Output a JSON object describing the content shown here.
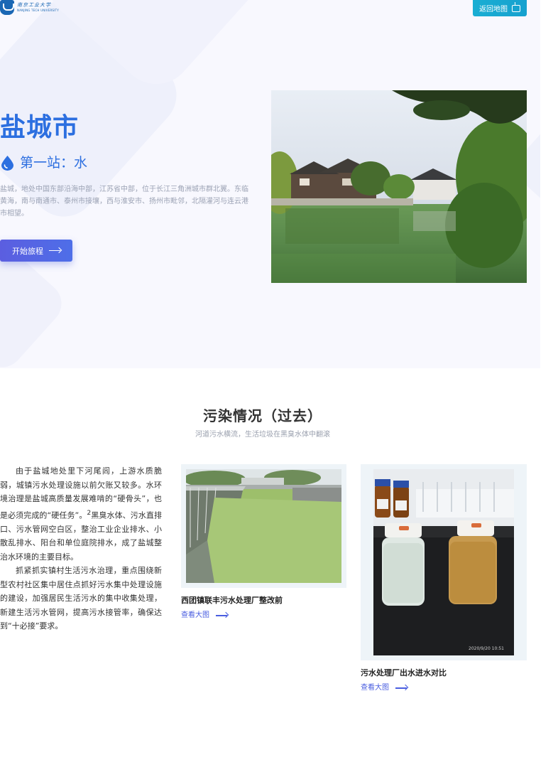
{
  "header": {
    "logo_name_cn": "南京工业大学",
    "logo_name_en": "NANJING TECH UNIVERSITY",
    "back_button_label": "返回地图"
  },
  "hero": {
    "city": "盐城市",
    "station": "第一站：水",
    "intro": "盐城，地处中国东部沿海中部，江苏省中部，位于长江三角洲城市群北翼。东临黄海，南与南通市、泰州市接壤，西与淮安市、扬州市毗邻，北隔灌河与连云港市相望。",
    "start_button_label": "开始旅程",
    "photo": "village-river-landscape"
  },
  "pollution": {
    "title": "污染情况（过去）",
    "subtitle": "河道污水横流，生活垃圾在黑臭水体中翻滚",
    "paragraph_1_pre": "由于盐城地处里下河尾闾，上游水质脆弱，城镇污水处理设施以前欠账又较多。水环境治理是盐城高质量发展难啃的“硬骨头”，也是必须完成的“硬任务”。",
    "paragraph_1_sup": "2",
    "paragraph_1_post": "黑臭水体、污水直排口、污水管网空白区，整治工业企业排水、小散乱排水、阳台和单位庭院排水，成了盐城整治水环境的主要目标。",
    "paragraph_2": "抓紧抓实镇村生活污水治理，重点围绕新型农村社区集中居住点抓好污水集中处理设施的建设，加强居民生活污水的集中收集处理，新建生活污水管网，提高污水接管率，确保达到“十必接”要求。",
    "cards": [
      {
        "caption": "西团镇联丰污水处理厂整改前",
        "link_label": "查看大图"
      },
      {
        "caption": "污水处理厂出水进水对比",
        "link_label": "查看大图",
        "photo_timestamp": "2020/9/20  10:51"
      }
    ]
  },
  "colors": {
    "brand_blue": "#2c6fe0",
    "button_gradient_start": "#5b5ee0",
    "back_button_teal": "#16a1cf",
    "link_blue": "#4a5ee0",
    "hero_background": "#f8f8fe"
  }
}
